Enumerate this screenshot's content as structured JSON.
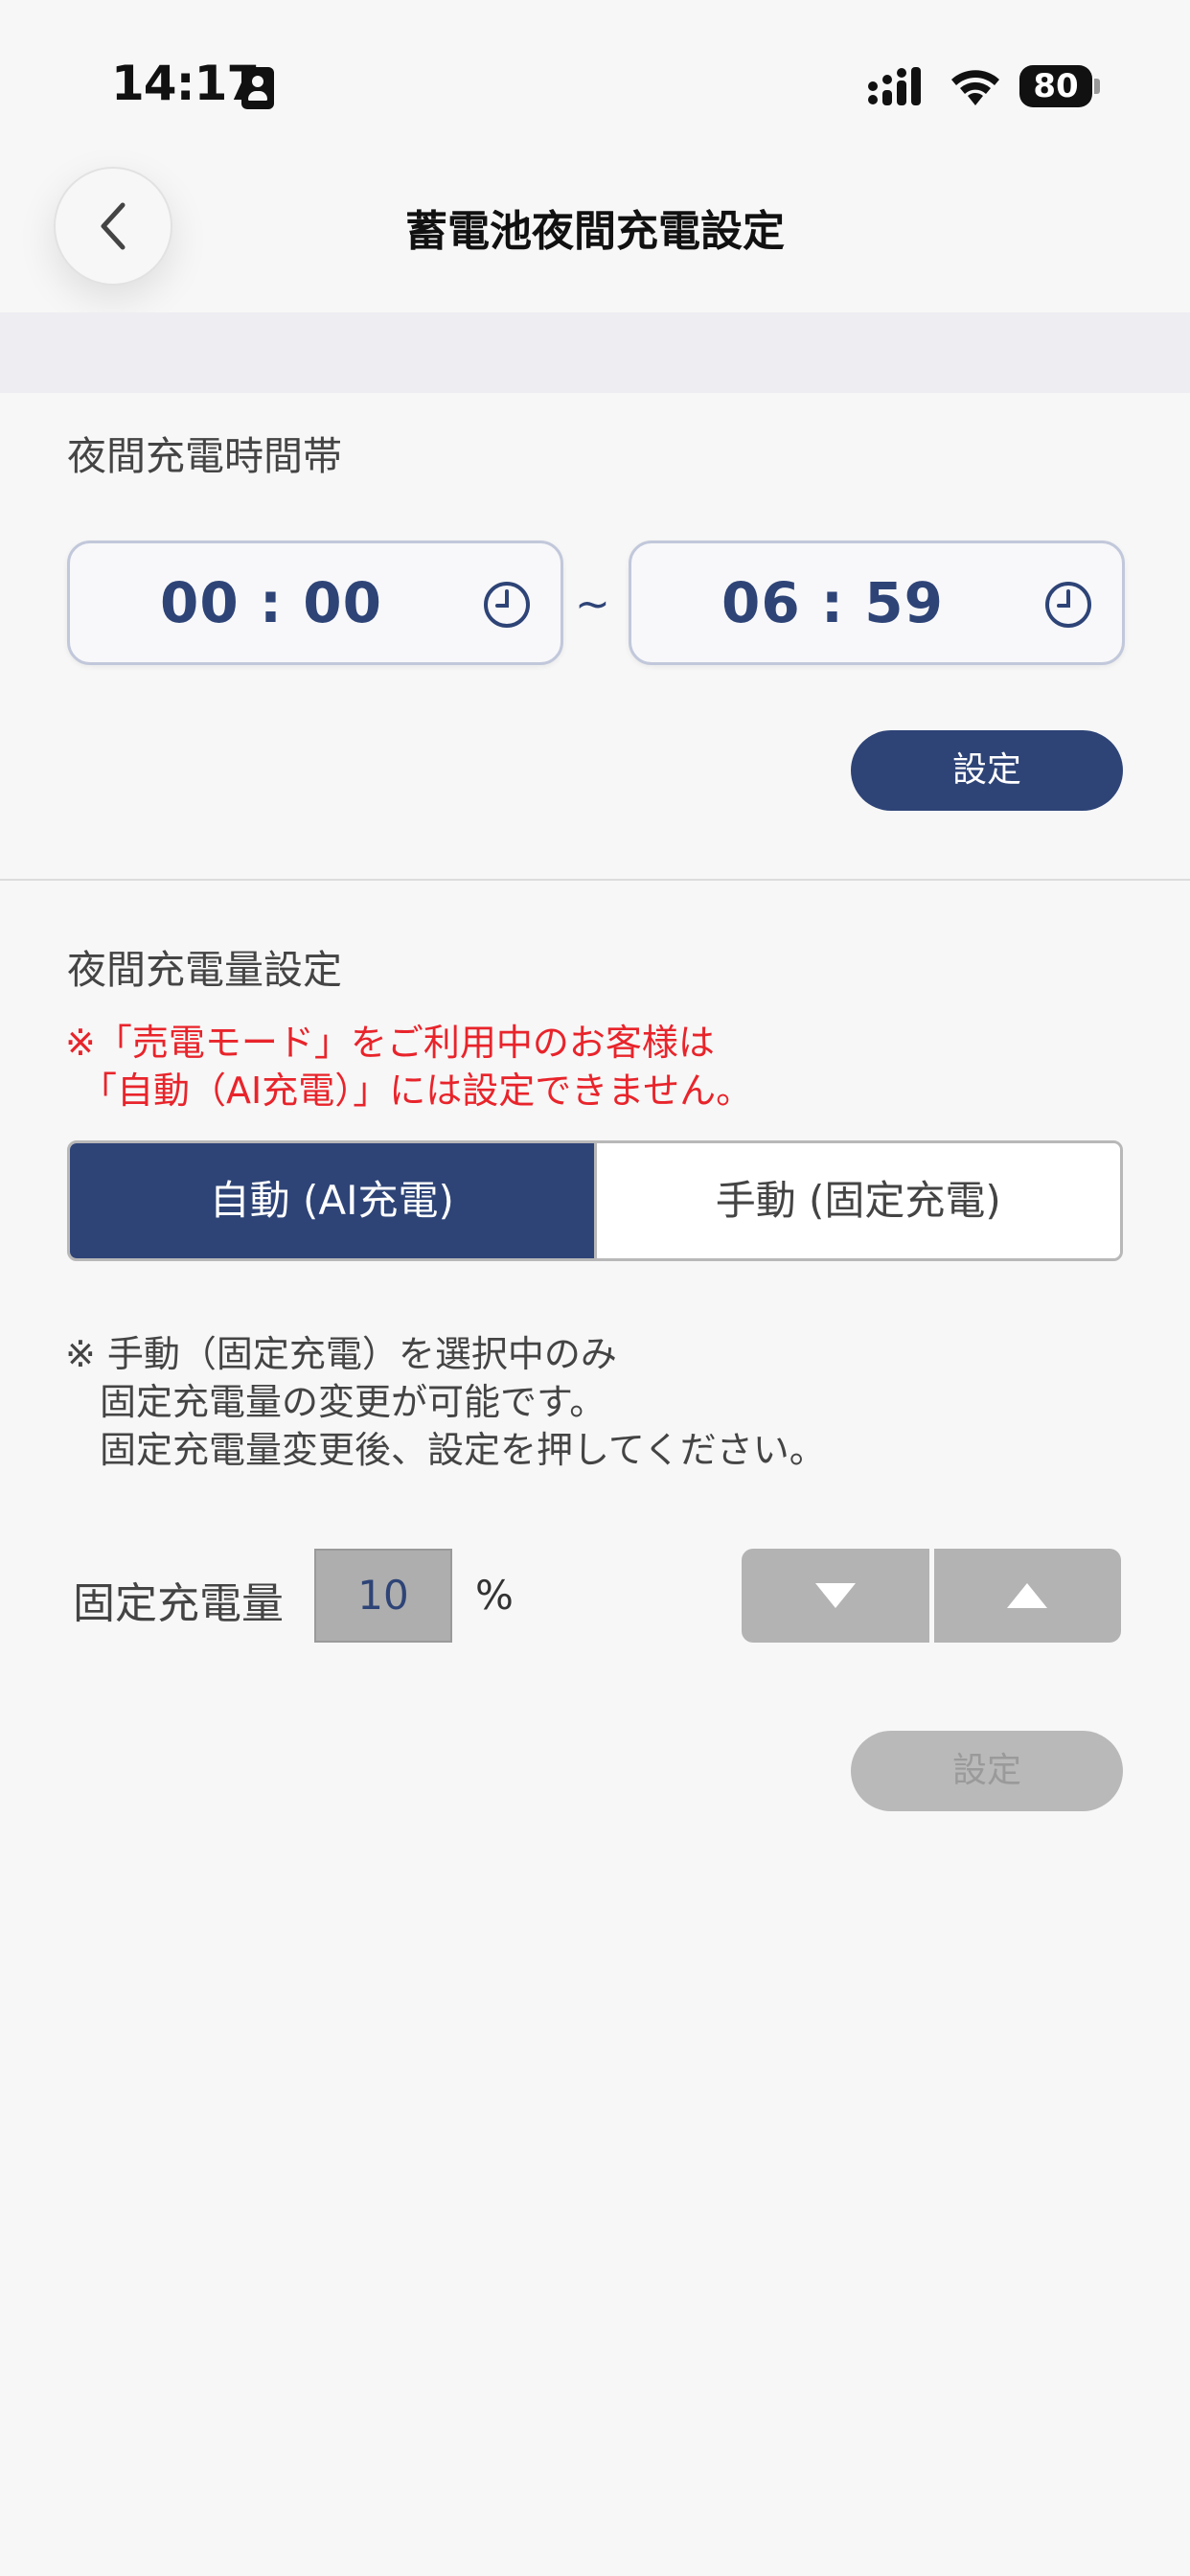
{
  "status_bar": {
    "time": "14:17",
    "battery": "80"
  },
  "header": {
    "title": "蓄電池夜間充電設定"
  },
  "night_time": {
    "section_title": "夜間充電時間帯",
    "start_time": "00 : 00",
    "separator": "~",
    "end_time": "06 : 59",
    "set_label": "設定"
  },
  "night_amount": {
    "section_title": "夜間充電量設定",
    "warning_line1": "※「売電モード」をご利用中のお客様は",
    "warning_line2": "「自動（AI充電）」には設定できません。",
    "mode_auto": "自動 (AI充電)",
    "mode_manual": "手動 (固定充電)",
    "note_line1": "※ 手動（固定充電）を選択中のみ",
    "note_line2": "固定充電量の変更が可能です。",
    "note_line3": "固定充電量変更後、設定を押してください。",
    "fixed_label": "固定充電量",
    "fixed_value": "10",
    "unit": "%",
    "set_label": "設定"
  },
  "colors": {
    "primary": "#2e4477",
    "warning": "#e8242b",
    "disabled": "#b3b3b3"
  }
}
